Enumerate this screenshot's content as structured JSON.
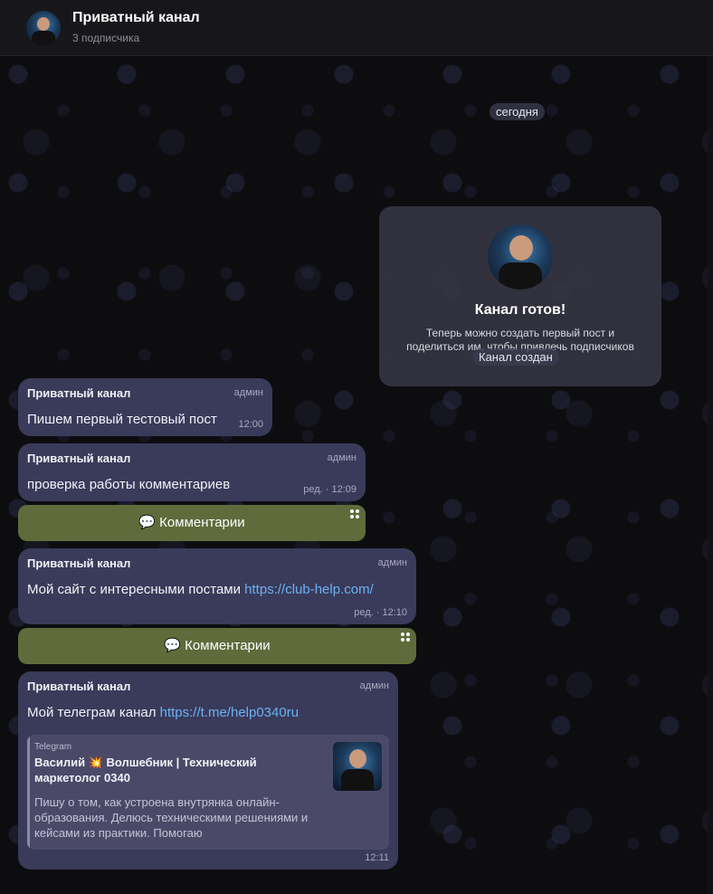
{
  "header": {
    "title": "Приватный канал",
    "subtitle": "3 подписчика"
  },
  "service": {
    "date": "сегодня",
    "created": "Канал создан"
  },
  "intro": {
    "title": "Канал готов!",
    "text": "Теперь можно создать первый пост и поделиться им, чтобы привлечь подписчиков"
  },
  "messages": [
    {
      "author": "Приватный канал",
      "role": "админ",
      "text": "Пишем первый тестовый пост",
      "time": "12:00"
    },
    {
      "author": "Приватный канал",
      "role": "админ",
      "text": "проверка работы комментариев",
      "time": "ред. · 12:09"
    },
    {
      "author": "Приватный канал",
      "role": "админ",
      "text_prefix": "Мой сайт с интересными постами ",
      "link": "https://club-help.com/",
      "time": "ред. · 12:10"
    },
    {
      "author": "Приватный канал",
      "role": "админ",
      "text_prefix": "Мой телеграм канал ",
      "link": "https://t.me/help0340ru",
      "time": "12:11",
      "preview": {
        "site": "Telegram",
        "title": "Василий 💥 Волшебник | Технический маркетолог 0340",
        "description": "Пишу о том, как устроена внутрянка онлайн-образования. Делюсь техническими решениями и кейсами из практики. Помогаю"
      }
    }
  ],
  "comments_label": "💬 Комментарии",
  "colors": {
    "bubble": "#3a3a5a",
    "comments_button": "#5f6b3b",
    "link": "#6ab2f2"
  }
}
